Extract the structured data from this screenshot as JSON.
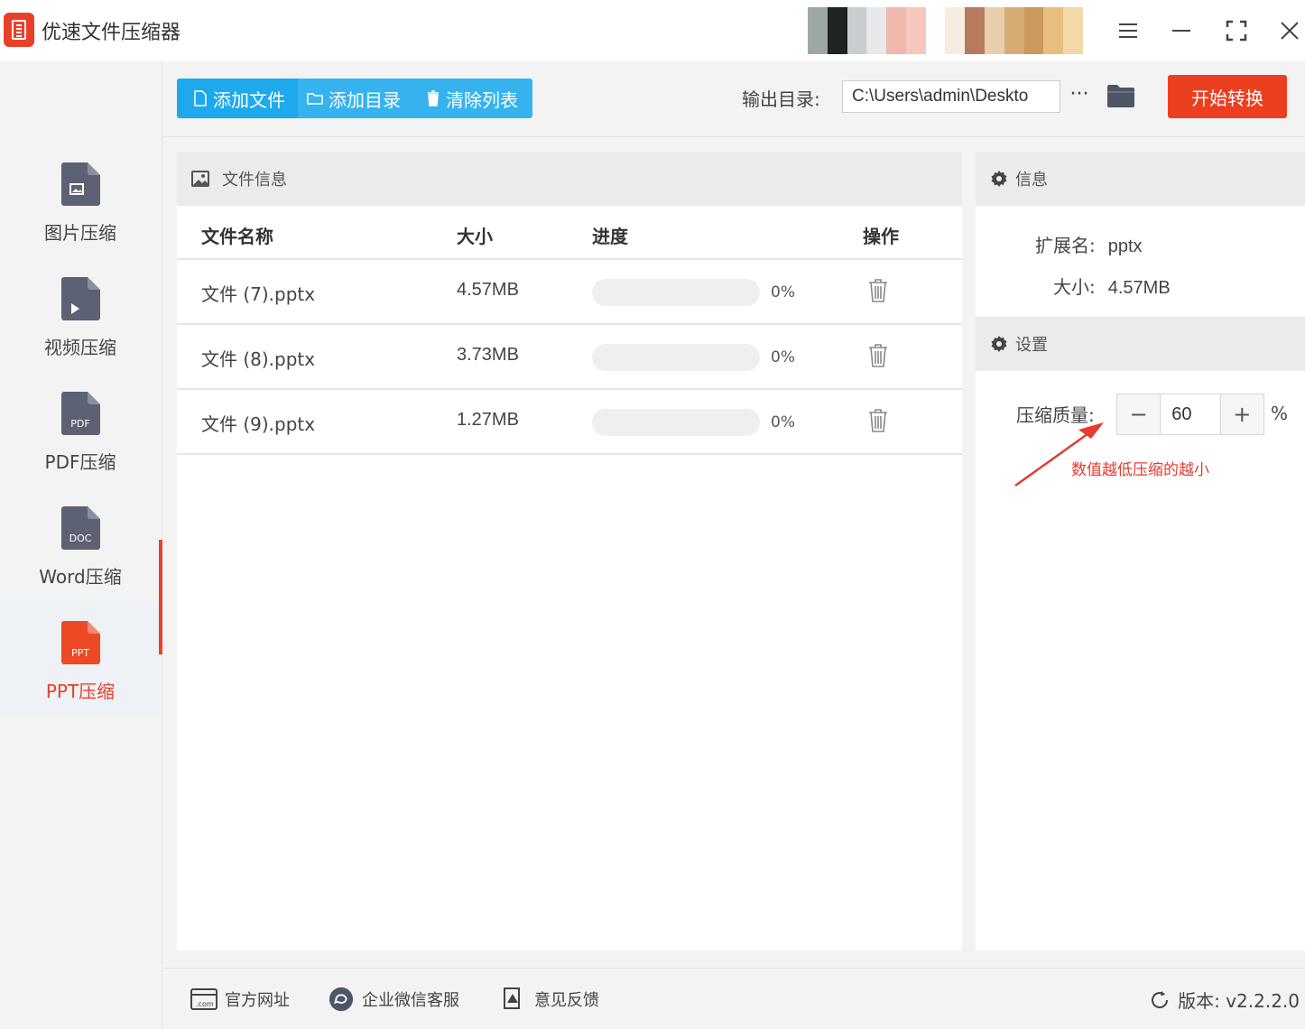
{
  "app": {
    "title": "优速文件压缩器"
  },
  "sidebar": {
    "items": [
      {
        "label": "图片压缩",
        "tag": ""
      },
      {
        "label": "视频压缩",
        "tag": ""
      },
      {
        "label": "PDF压缩",
        "tag": "PDF"
      },
      {
        "label": "Word压缩",
        "tag": "DOC"
      },
      {
        "label": "PPT压缩",
        "tag": "PPT"
      }
    ],
    "active_index": 4
  },
  "toolbar": {
    "add_file": "添加文件",
    "add_dir": "添加目录",
    "clear_list": "清除列表",
    "output_label": "输出目录:",
    "output_path": "C:\\Users\\admin\\Deskto",
    "more": "···",
    "start": "开始转换"
  },
  "file_panel": {
    "title": "文件信息",
    "columns": {
      "name": "文件名称",
      "size": "大小",
      "progress": "进度",
      "action": "操作"
    },
    "rows": [
      {
        "name": "文件 (7).pptx",
        "size": "4.57MB",
        "progress": 0,
        "progress_label": "0%"
      },
      {
        "name": "文件 (8).pptx",
        "size": "3.73MB",
        "progress": 0,
        "progress_label": "0%"
      },
      {
        "name": "文件 (9).pptx",
        "size": "1.27MB",
        "progress": 0,
        "progress_label": "0%"
      }
    ]
  },
  "info_panel": {
    "title": "信息",
    "ext_label": "扩展名:",
    "ext_value": "pptx",
    "size_label": "大小:",
    "size_value": "4.57MB"
  },
  "settings_panel": {
    "title": "设置",
    "quality_label": "压缩质量:",
    "quality_minus": "−",
    "quality_value": "60",
    "quality_plus": "+",
    "quality_unit": "%",
    "annotation": "数值越低压缩的越小"
  },
  "footer": {
    "website": "官方网址",
    "wechat": "企业微信客服",
    "feedback": "意见反馈",
    "version": "版本:  v2.2.2.0"
  },
  "colors": {
    "accent": "#e9402a",
    "blue": "#36b3ee",
    "start_button": "#ec3f1f",
    "file_icon": "#5c6173"
  }
}
